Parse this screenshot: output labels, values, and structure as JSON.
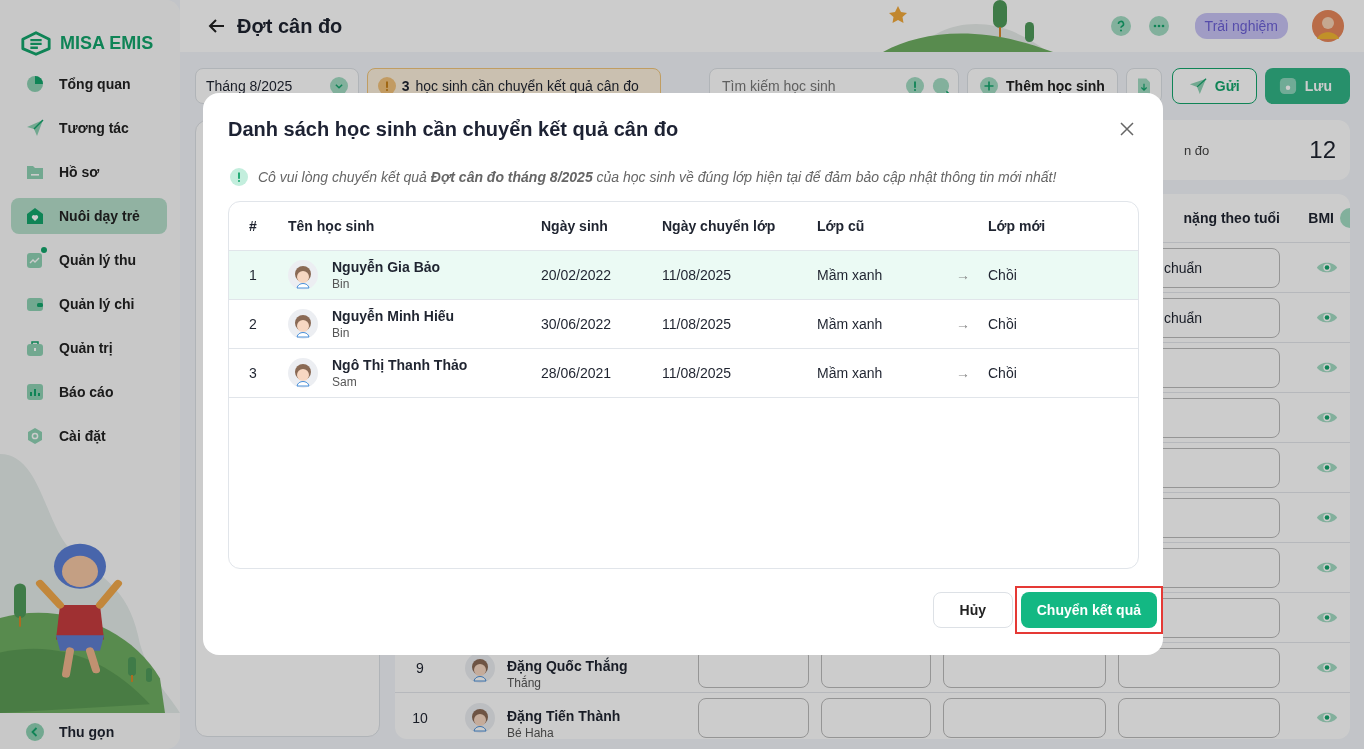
{
  "sidebar": {
    "logo": "MISA EMIS",
    "items": [
      {
        "label": "Tổng quan",
        "selected": false,
        "notification": false
      },
      {
        "label": "Tương tác",
        "selected": false,
        "notification": false
      },
      {
        "label": "Hồ sơ",
        "selected": false,
        "notification": false
      },
      {
        "label": "Nuôi dạy trẻ",
        "selected": true,
        "notification": false
      },
      {
        "label": "Quản lý thu",
        "selected": false,
        "notification": true
      },
      {
        "label": "Quản lý chi",
        "selected": false,
        "notification": false
      },
      {
        "label": "Quản trị",
        "selected": false,
        "notification": false
      },
      {
        "label": "Báo cáo",
        "selected": false,
        "notification": false
      },
      {
        "label": "Cài đặt",
        "selected": false,
        "notification": false
      }
    ],
    "collapse": "Thu gọn"
  },
  "header": {
    "title": "Đợt cân đo",
    "trial_badge": "Trải nghiệm"
  },
  "toolbar": {
    "month": "Tháng 8/2025",
    "warning": {
      "count": "3",
      "text": "học sinh cần chuyển kết quả cân đo"
    },
    "search": {
      "placeholder": "Tìm kiếm học sinh"
    },
    "add_button": "Thêm học sinh",
    "send_button": "Gửi",
    "save_button": "Lưu"
  },
  "stat_card": {
    "label": "n đo",
    "value": "12"
  },
  "table": {
    "columns": [
      "nặng theo tuổi",
      "BMI"
    ],
    "rows": [
      {
        "weight_for_age": "chuẩn"
      },
      {
        "weight_for_age": "chuẩn"
      },
      {},
      {},
      {},
      {},
      {},
      {},
      {
        "number": "9",
        "name": "Đặng Quốc Thắng",
        "nickname": "Thắng"
      },
      {
        "number": "10",
        "name": "Đặng Tiến Thành",
        "nickname": "Bé Haha"
      }
    ]
  },
  "dialog": {
    "title": "Danh sách học sinh cần chuyển kết quả cân đo",
    "notice": "Cô vui lòng chuyển kết quả **Đợt cân đo tháng 8/2025** của học sinh về đúng lớp hiện tại để đảm bảo cập nhật thông tin mới nhất!",
    "columns": [
      "#",
      "Tên học sinh",
      "Ngày sinh",
      "Ngày chuyển lớp",
      "Lớp cũ",
      "Lớp mới"
    ],
    "rows": [
      {
        "number": "1",
        "name": "Nguyễn Gia Bảo",
        "nickname": "Bin",
        "birth_date": "20/02/2022",
        "transfer_date": "11/08/2025",
        "old_class": "Mầm xanh",
        "arrow": "→",
        "new_class": "Chồi",
        "selected": true
      },
      {
        "number": "2",
        "name": "Nguyễn Minh Hiếu",
        "nickname": "Bin",
        "birth_date": "30/06/2022",
        "transfer_date": "11/08/2025",
        "old_class": "Mầm xanh",
        "arrow": "→",
        "new_class": "Chồi",
        "selected": false
      },
      {
        "number": "3",
        "name": "Ngô Thị Thanh Thảo",
        "nickname": "Sam",
        "birth_date": "28/06/2021",
        "transfer_date": "11/08/2025",
        "old_class": "Mầm xanh",
        "arrow": "→",
        "new_class": "Chồi",
        "selected": false
      }
    ],
    "cancel_button": "Hủy",
    "confirm_button": {
      "label": "Chuyển kết quả",
      "highlighted": true
    }
  }
}
